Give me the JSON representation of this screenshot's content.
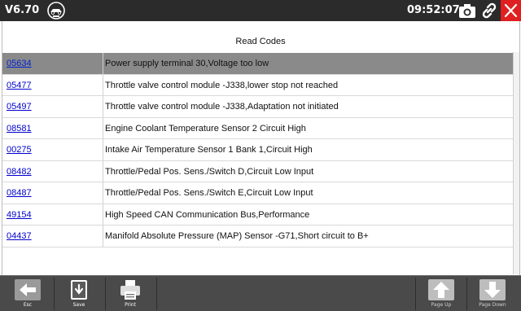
{
  "header": {
    "version": "V6.70",
    "clock": "09:52:07"
  },
  "page": {
    "title": "Read Codes"
  },
  "codes": [
    {
      "code": "05634",
      "desc": "Power supply terminal 30,Voltage too low"
    },
    {
      "code": "05477",
      "desc": "Throttle valve control module -J338,lower stop not reached"
    },
    {
      "code": "05497",
      "desc": "Throttle valve control module -J338,Adaptation not initiated"
    },
    {
      "code": "08581",
      "desc": "Engine Coolant Temperature Sensor 2 Circuit High"
    },
    {
      "code": "00275",
      "desc": "Intake Air Temperature Sensor 1 Bank 1,Circuit High"
    },
    {
      "code": "08482",
      "desc": "Throttle/Pedal Pos. Sens./Switch D,Circuit Low Input"
    },
    {
      "code": "08487",
      "desc": "Throttle/Pedal Pos. Sens./Switch E,Circuit Low Input"
    },
    {
      "code": "49154",
      "desc": "High Speed CAN Communication Bus,Performance"
    },
    {
      "code": "04437",
      "desc": "Manifold Absolute Pressure (MAP) Sensor -G71,Short circuit to B+"
    }
  ],
  "toolbar": {
    "esc_label": "Esc",
    "save_label": "Save",
    "print_label": "Print",
    "page_up_label": "Page Up",
    "page_down_label": "Page Down"
  },
  "colors": {
    "topbar": "#2b2b2b",
    "close": "#e02020",
    "selected_row": "#8a8a8a",
    "link": "#0000cc",
    "toolbar": "#4a4a4a"
  }
}
